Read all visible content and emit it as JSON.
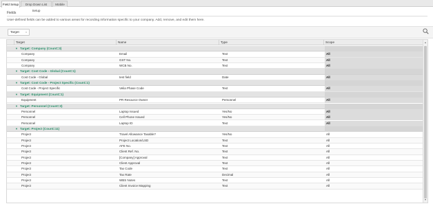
{
  "tabs": [
    {
      "label": "Field Setup",
      "active": true
    },
    {
      "label": "Drop Down List Setup",
      "active": false
    },
    {
      "label": "Mobile",
      "active": false
    }
  ],
  "section": {
    "title": "Fields",
    "description": "User-defined fields can be added to various areas for recording information specific to your company. Add, remove, and edit them here."
  },
  "filter": {
    "chip_label": "Target",
    "chip_remove": "x"
  },
  "grid": {
    "columns": [
      "Target",
      "Name",
      "Type",
      "Scope"
    ],
    "groups": [
      {
        "title": "Target: Company (Count=3)",
        "rows": [
          {
            "target": "Company",
            "name": "Email",
            "type": "Text",
            "scope": "All"
          },
          {
            "target": "Company",
            "name": "GST No.",
            "type": "Text",
            "scope": "All"
          },
          {
            "target": "Company",
            "name": "WCB No.",
            "type": "Text",
            "scope": "All"
          }
        ]
      },
      {
        "title": "Target: Cost Code - Global (Count=1)",
        "rows": [
          {
            "target": "Cost Code - Global",
            "name": "test field",
            "type": "Date",
            "scope": "All"
          }
        ]
      },
      {
        "title": "Target: Cost Code - Project Specific (Count=1)",
        "rows": [
          {
            "target": "Cost Code - Project Specific",
            "name": "Velia Phase Code",
            "type": "Text",
            "scope": "All"
          }
        ]
      },
      {
        "title": "Target: Equipment (Count=1)",
        "rows": [
          {
            "target": "Equipment",
            "name": "PR Resource Owner",
            "type": "Personnel",
            "scope": "All"
          }
        ]
      },
      {
        "title": "Target: Personnel (Count=3)",
        "rows": [
          {
            "target": "Personnel",
            "name": "Laptop Issued",
            "type": "Yes/No",
            "scope": "All"
          },
          {
            "target": "Personnel",
            "name": "Cell Phone Issued",
            "type": "Yes/No",
            "scope": "All"
          },
          {
            "target": "Personnel",
            "name": "Laptop ID",
            "type": "Text",
            "scope": "All"
          }
        ]
      },
      {
        "title": "Target: Project (Count=11)",
        "rows": [
          {
            "target": "Project",
            "name": "Travel Allowance Taxable?",
            "type": "Yes/No",
            "scope": "All"
          },
          {
            "target": "Project",
            "name": "Project Location/LSD",
            "type": "Text",
            "scope": "All"
          },
          {
            "target": "Project",
            "name": "AFE No.",
            "type": "Text",
            "scope": "All"
          },
          {
            "target": "Project",
            "name": "Client Ref. No.",
            "type": "Text",
            "scope": "All"
          },
          {
            "target": "Project",
            "name": "[Company] Approval",
            "type": "Text",
            "scope": "All"
          },
          {
            "target": "Project",
            "name": "Client Approval",
            "type": "Text",
            "scope": "All"
          },
          {
            "target": "Project",
            "name": "Tax Code",
            "type": "Text",
            "scope": "All"
          },
          {
            "target": "Project",
            "name": "Tax Rate",
            "type": "Decimal",
            "scope": "All"
          },
          {
            "target": "Project",
            "name": "WBS Notes",
            "type": "Text",
            "scope": "All"
          },
          {
            "target": "Project",
            "name": "Client Invoice Mapping",
            "type": "Text",
            "scope": "All"
          }
        ]
      }
    ]
  },
  "icons": {
    "search": "search-icon",
    "collapse": "chevron-down-icon",
    "expand": "chevron-right-icon"
  },
  "colors": {
    "group_text": "#2a8f6a",
    "scope_fill": "#dcdcdc",
    "header_bg": "#ececec"
  }
}
